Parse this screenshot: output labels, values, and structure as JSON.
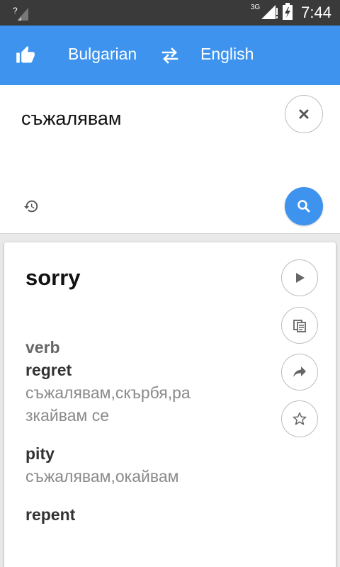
{
  "status_bar": {
    "network_label": "3G",
    "time": "7:44"
  },
  "app_bar": {
    "source_language": "Bulgarian",
    "target_language": "English",
    "accent_color": "#3d93ee"
  },
  "input": {
    "text": "съжалявам"
  },
  "result": {
    "word": "sorry",
    "entries": [
      {
        "part_of_speech": "verb",
        "word": "regret",
        "synonyms": "съжалявам,скърбя,разкайвам се"
      },
      {
        "part_of_speech": "",
        "word": "pity",
        "synonyms": "съжалявам,окайвам"
      },
      {
        "part_of_speech": "",
        "word": "repent",
        "synonyms": ""
      }
    ]
  },
  "icons": {
    "like": "thumbs-up-icon",
    "swap": "swap-icon",
    "clear": "close-icon",
    "history": "history-icon",
    "search": "search-icon",
    "play": "play-icon",
    "copy": "copy-icon",
    "share": "share-icon",
    "favorite": "star-icon"
  }
}
